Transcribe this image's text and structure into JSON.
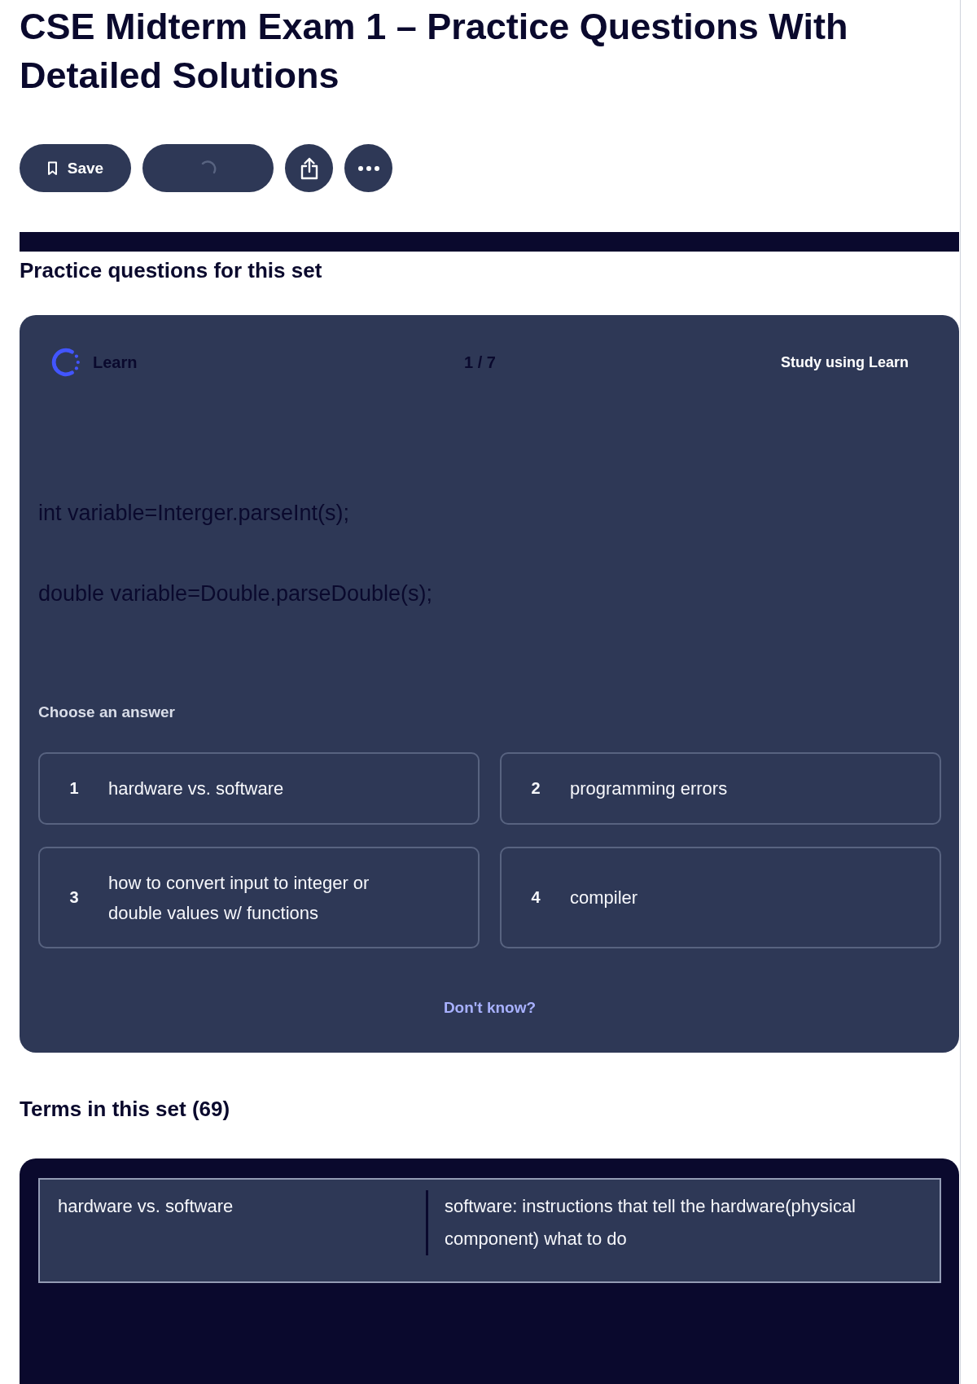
{
  "title": "CSE Midterm Exam 1 – Practice Questions With Detailed Solutions",
  "actions": [
    {
      "kind": "save",
      "label": "Save"
    },
    {
      "kind": "loading"
    },
    {
      "kind": "share"
    },
    {
      "kind": "more"
    }
  ],
  "practice": {
    "heading": "Practice questions for this set",
    "card": {
      "mode": "Learn",
      "progress": "1 / 7",
      "study_link": "Study using Learn",
      "prompt_lines": [
        "int variable=Interger.parseInt(s);",
        "double variable=Double.parseDouble(s);"
      ],
      "instruction": "Choose an answer",
      "options": [
        {
          "number": "1",
          "text": "hardware vs. software",
          "selected": false
        },
        {
          "number": "2",
          "text": "programming errors",
          "selected": false
        },
        {
          "number": "3",
          "text": "how to convert input to integer or double values w/ functions",
          "selected": false
        },
        {
          "number": "4",
          "text": "compiler",
          "selected": false
        }
      ],
      "skip": "Don't know?"
    }
  },
  "terms": {
    "heading": "Terms in this set (69)",
    "items": [
      {
        "term": "hardware vs. software",
        "definition": "software: instructions that tell the hardware(physical component) what to do"
      }
    ]
  }
}
